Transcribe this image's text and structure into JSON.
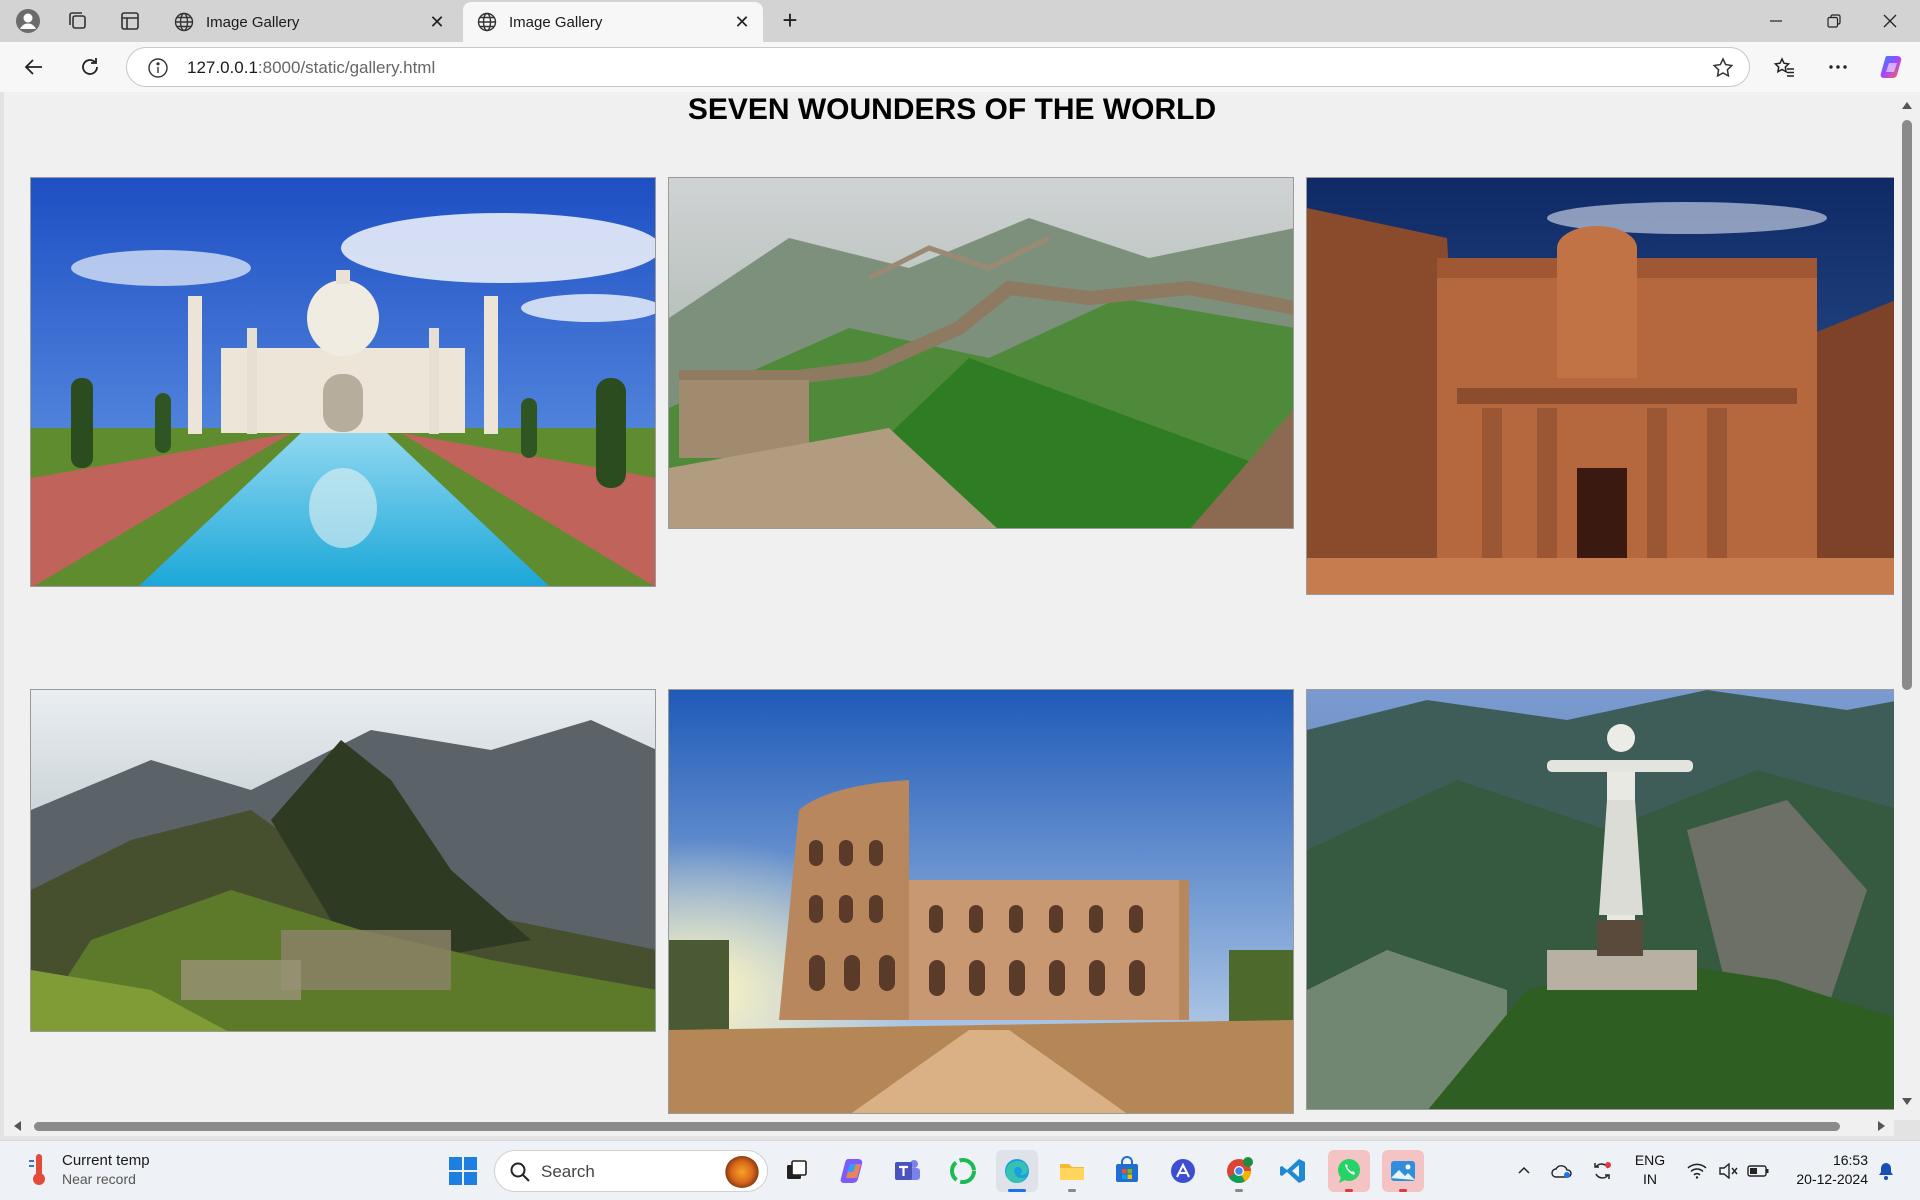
{
  "browser": {
    "tabs": [
      {
        "title": "Image Gallery",
        "close": "✕"
      },
      {
        "title": "Image Gallery",
        "close": "✕"
      }
    ],
    "new_tab": "+",
    "address": {
      "host": "127.0.0.1",
      "path": ":8000/static/gallery.html"
    }
  },
  "page": {
    "title": "SEVEN WOUNDERS OF THE WORLD",
    "images": [
      {
        "subject": "Taj Mahal"
      },
      {
        "subject": "Great Wall of China"
      },
      {
        "subject": "Petra"
      },
      {
        "subject": "Machu Picchu"
      },
      {
        "subject": "Colosseum"
      },
      {
        "subject": "Christ the Redeemer"
      }
    ]
  },
  "taskbar": {
    "weather": {
      "title": "Current temp",
      "subtitle": "Near record"
    },
    "search_placeholder": "Search",
    "language": {
      "line1": "ENG",
      "line2": "IN"
    },
    "clock": {
      "time": "16:53",
      "date": "20-12-2024"
    }
  },
  "colors": {
    "accent": "#1a73e8",
    "tab_strip": "#d3d3d3",
    "page_bg": "#f0f0f0"
  }
}
